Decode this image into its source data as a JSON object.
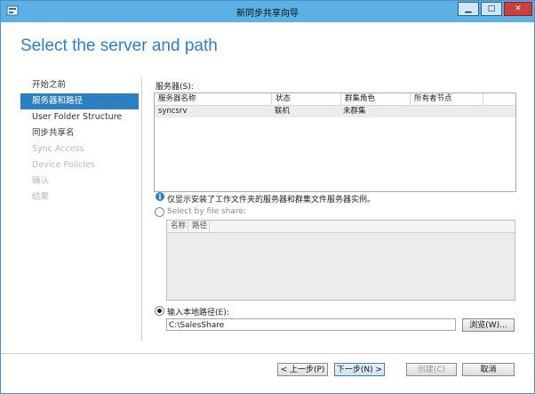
{
  "window": {
    "title": "新同步共享向导"
  },
  "heading": "Select the server and path",
  "nav": {
    "items": [
      {
        "label": "开始之前",
        "state": "normal"
      },
      {
        "label": "服务器和路径",
        "state": "selected"
      },
      {
        "label": "User Folder Structure",
        "state": "normal"
      },
      {
        "label": "同步共享名",
        "state": "normal"
      },
      {
        "label": "Sync Access",
        "state": "disabled"
      },
      {
        "label": "Device Policies",
        "state": "disabled"
      },
      {
        "label": "确认",
        "state": "disabled"
      },
      {
        "label": "结果",
        "state": "disabled"
      }
    ]
  },
  "servers": {
    "label": "服务器(S):",
    "columns": [
      "服务器名称",
      "状态",
      "群集角色",
      "所有者节点"
    ],
    "rows": [
      {
        "name": "syncsrv",
        "status": "联机",
        "role": "未群集",
        "owner": ""
      }
    ]
  },
  "info_text": "仅显示安装了工作文件夹的服务器和群集文件服务器实例。",
  "share_option": {
    "label": "Select by file share:",
    "columns": [
      "名称",
      "路径"
    ]
  },
  "local_option": {
    "label": "输入本地路径(E):",
    "value": "C:\\SalesShare",
    "browse_label": "浏览(W)..."
  },
  "footer": {
    "prev": "< 上一步(P)",
    "next": "下一步(N) >",
    "create": "创建(C)",
    "cancel": "取消"
  }
}
